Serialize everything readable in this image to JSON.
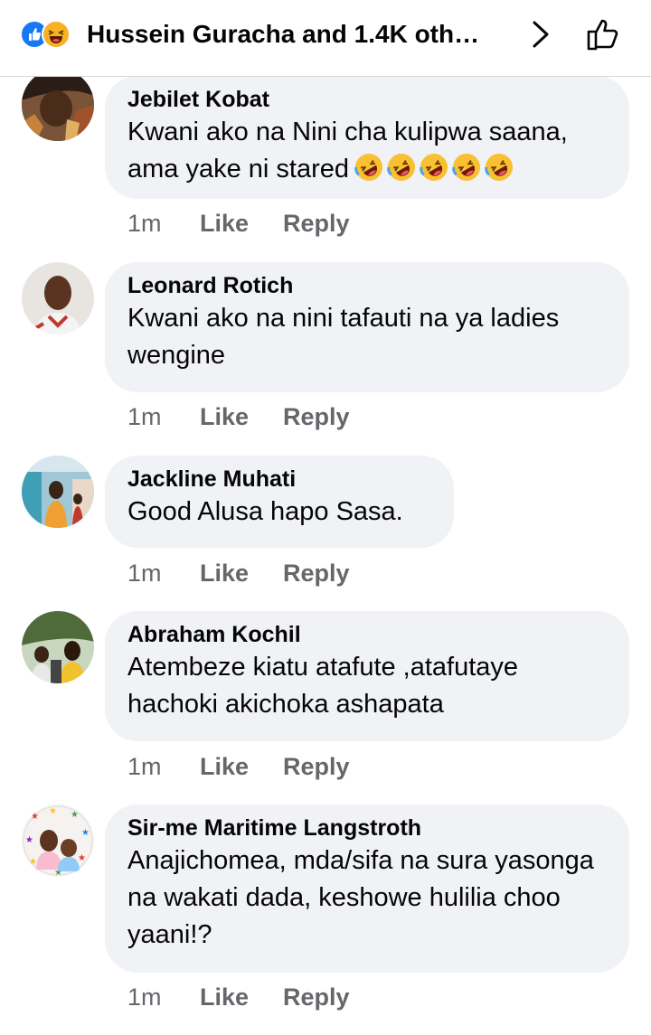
{
  "header": {
    "title": "Hussein Guracha and 1.4K oth…",
    "reaction_icons": [
      "like-reaction-icon",
      "haha-reaction-icon"
    ],
    "chevron_icon": "chevron-right-icon",
    "like_icon": "thumbs-up-outline-icon"
  },
  "comments": [
    {
      "author": "Jebilet Kobat",
      "text_line1": "Kwani ako na Nini cha kulipwa saana,",
      "text_line2": "ama yake ni stared",
      "emoji": [
        "rolling-on-floor-laughing",
        "rolling-on-floor-laughing",
        "rolling-on-floor-laughing",
        "rolling-on-floor-laughing",
        "rolling-on-floor-laughing"
      ],
      "time": "1m",
      "like": "Like",
      "reply": "Reply"
    },
    {
      "author": "Leonard Rotich",
      "text": "Kwani ako na nini tafauti na ya ladies wengine",
      "time": "1m",
      "like": "Like",
      "reply": "Reply"
    },
    {
      "author": "Jackline Muhati",
      "text": "Good Alusa hapo Sasa.",
      "time": "1m",
      "like": "Like",
      "reply": "Reply"
    },
    {
      "author": "Abraham Kochil",
      "text": "Atembeze kiatu atafute ,atafutaye hachoki akichoka ashapata",
      "time": "1m",
      "like": "Like",
      "reply": "Reply"
    },
    {
      "author": "Sir-me Maritime Langstroth",
      "text": "Anajichomea, mda/sifa na sura yasonga na wakati dada, keshowe hulilia choo yaani!?",
      "time": "1m",
      "like": "Like",
      "reply": "Reply"
    }
  ],
  "colors": {
    "bubble": "#f0f2f5",
    "action_text": "#65676b",
    "like_blue": "#1877f2",
    "haha_yellow": "#f7b125"
  }
}
